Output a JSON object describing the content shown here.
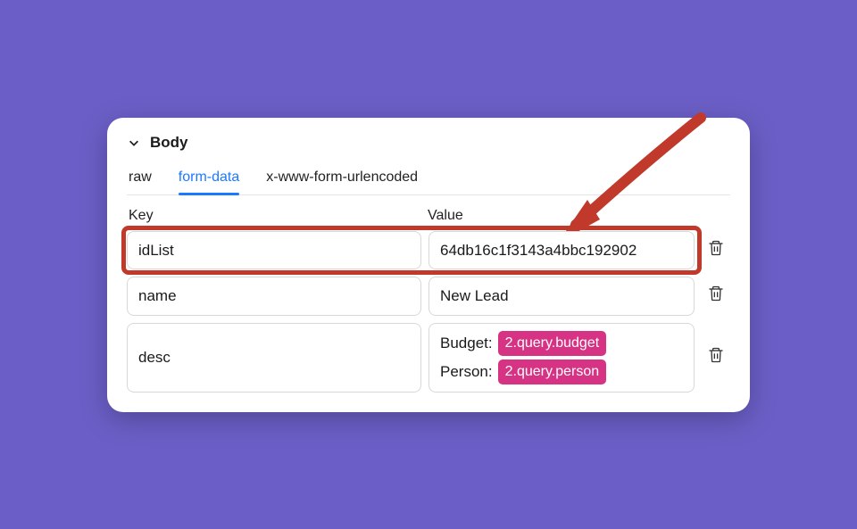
{
  "section": {
    "title": "Body"
  },
  "tabs": {
    "raw": "raw",
    "formData": "form-data",
    "urlencoded": "x-www-form-urlencoded",
    "active": "form-data"
  },
  "headers": {
    "key": "Key",
    "value": "Value"
  },
  "rows": [
    {
      "key": "idList",
      "value": {
        "type": "text",
        "text": "64db16c1f3143a4bbc192902"
      },
      "highlighted": true
    },
    {
      "key": "name",
      "value": {
        "type": "text",
        "text": "New Lead"
      },
      "highlighted": false
    },
    {
      "key": "desc",
      "value": {
        "type": "rich",
        "lines": [
          {
            "label": "Budget:",
            "chip": "2.query.budget"
          },
          {
            "label": "Person:",
            "chip": "2.query.person"
          }
        ]
      },
      "highlighted": false
    }
  ],
  "colors": {
    "background": "#6b5fc7",
    "accent": "#1a7aff",
    "highlightBorder": "#c0392b",
    "chip": "#d63384"
  }
}
